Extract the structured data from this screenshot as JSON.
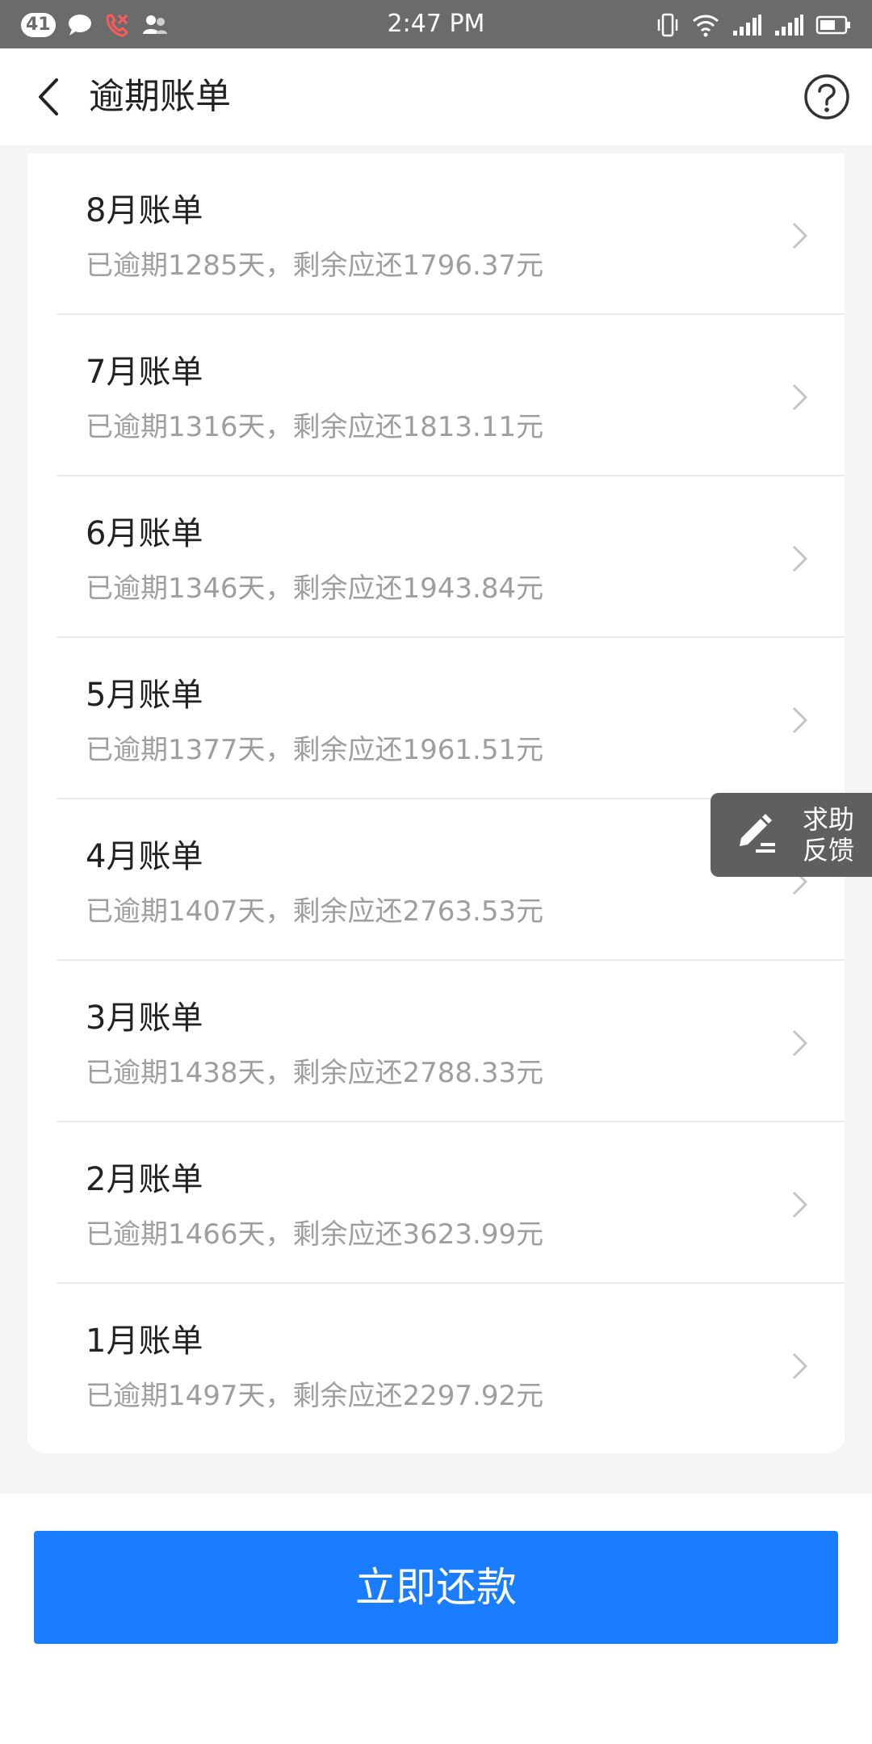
{
  "status_bar": {
    "notification_count": "41",
    "time": "2:47 PM",
    "icons": [
      "chat-bubble-icon",
      "missed-call-icon",
      "contacts-icon",
      "vibrate-icon",
      "wifi-icon",
      "signal-icon",
      "signal-2-icon",
      "battery-icon"
    ]
  },
  "header": {
    "title": "逾期账单",
    "back_icon": "chevron-left-icon",
    "help_icon": "question-circle-icon"
  },
  "bills": [
    {
      "title": "8月账单",
      "desc": "已逾期1285天，剩余应还1796.37元"
    },
    {
      "title": "7月账单",
      "desc": "已逾期1316天，剩余应还1813.11元"
    },
    {
      "title": "6月账单",
      "desc": "已逾期1346天，剩余应还1943.84元"
    },
    {
      "title": "5月账单",
      "desc": "已逾期1377天，剩余应还1961.51元"
    },
    {
      "title": "4月账单",
      "desc": "已逾期1407天，剩余应还2763.53元"
    },
    {
      "title": "3月账单",
      "desc": "已逾期1438天，剩余应还2788.33元"
    },
    {
      "title": "2月账单",
      "desc": "已逾期1466天，剩余应还3623.99元"
    },
    {
      "title": "1月账单",
      "desc": "已逾期1497天，剩余应还2297.92元"
    }
  ],
  "float_help": {
    "line1": "求助",
    "line2": "反馈",
    "icon": "pen-icon"
  },
  "pay_button_label": "立即还款",
  "colors": {
    "primary": "#1a7cff",
    "status_bar": "#6b6b6b",
    "secondary_text": "#9e9e9e"
  }
}
